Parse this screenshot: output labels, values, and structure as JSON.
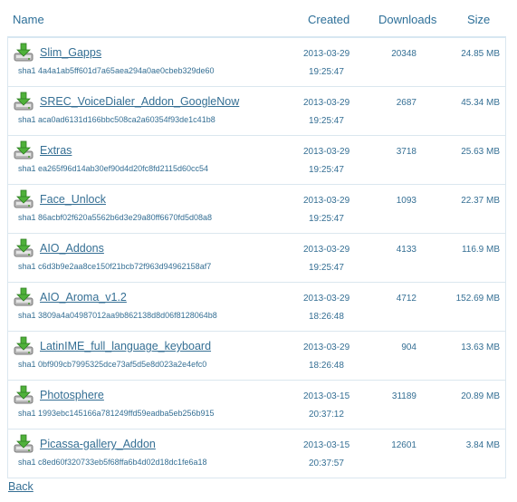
{
  "columns": {
    "name": "Name",
    "created": "Created",
    "downloads": "Downloads",
    "size": "Size"
  },
  "files": [
    {
      "name": "Slim_Gapps",
      "sha": "sha1 4a4a1ab5ff601d7a65aea294a0ae0cbeb329de60",
      "date": "2013-03-29",
      "time": "19:25:47",
      "downloads": "20348",
      "size": "24.85 MB"
    },
    {
      "name": "SREC_VoiceDialer_Addon_GoogleNow",
      "sha": "sha1 aca0ad6131d166bbc508ca2a60354f93de1c41b8",
      "date": "2013-03-29",
      "time": "19:25:47",
      "downloads": "2687",
      "size": "45.34 MB"
    },
    {
      "name": "Extras",
      "sha": "sha1 ea265f96d14ab30ef90d4d20fc8fd2115d60cc54",
      "date": "2013-03-29",
      "time": "19:25:47",
      "downloads": "3718",
      "size": "25.63 MB"
    },
    {
      "name": "Face_Unlock",
      "sha": "sha1 86acbf02f620a5562b6d3e29a80ff6670fd5d08a8",
      "date": "2013-03-29",
      "time": "19:25:47",
      "downloads": "1093",
      "size": "22.37 MB"
    },
    {
      "name": "AIO_Addons",
      "sha": "sha1 c6d3b9e2aa8ce150f21bcb72f963d94962158af7",
      "date": "2013-03-29",
      "time": "19:25:47",
      "downloads": "4133",
      "size": "116.9 MB"
    },
    {
      "name": "AIO_Aroma_v1.2",
      "sha": "sha1 3809a4a04987012aa9b862138d8d06f8128064b8",
      "date": "2013-03-29",
      "time": "18:26:48",
      "downloads": "4712",
      "size": "152.69 MB"
    },
    {
      "name": "LatinIME_full_language_keyboard",
      "sha": "sha1 0bf909cb7995325dce73af5d5e8d023a2e4efc0",
      "date": "2013-03-29",
      "time": "18:26:48",
      "downloads": "904",
      "size": "13.63 MB"
    },
    {
      "name": "Photosphere",
      "sha": "sha1 1993ebc145166a781249ffd59eadba5eb256b915",
      "date": "2013-03-15",
      "time": "20:37:12",
      "downloads": "31189",
      "size": "20.89 MB"
    },
    {
      "name": "Picassa-gallery_Addon",
      "sha": "sha1 c8ed60f320733eb5f68ffa6b4d02d18dc1fe6a18",
      "date": "2013-03-15",
      "time": "20:37:57",
      "downloads": "12601",
      "size": "3.84 MB"
    }
  ],
  "back_label": "Back"
}
